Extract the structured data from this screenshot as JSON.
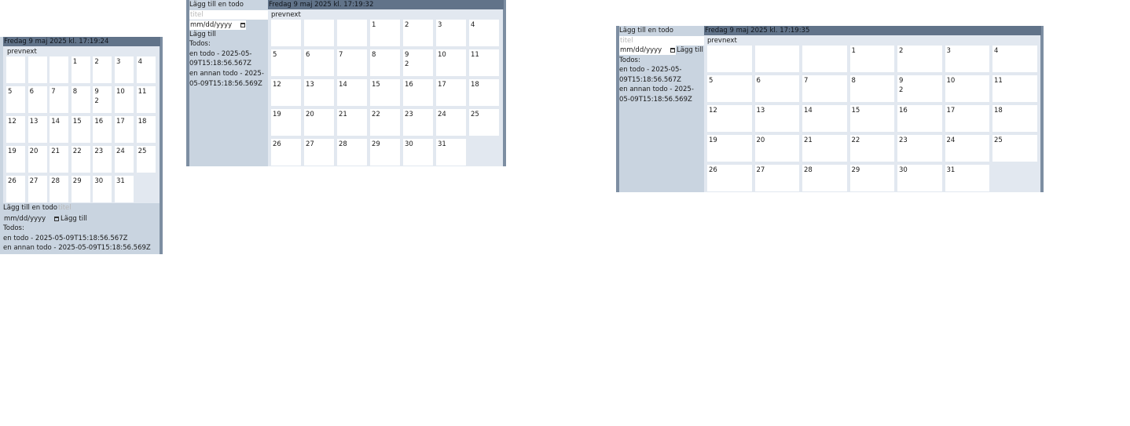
{
  "texts": {
    "prev": "prev",
    "next": "next",
    "add_heading": "Lägg till en todo",
    "title_placeholder": "titel",
    "date_placeholder": "mm/dd/yyyy",
    "add_button": "Lägg till",
    "todos_heading": "Todos:"
  },
  "windows": [
    {
      "header": "Fredag 9 maj 2025 kl. 17:19:24"
    },
    {
      "header": "Fredag 9 maj 2025 kl. 17:19:32"
    },
    {
      "header": "Fredag 9 maj 2025 kl. 17:19:35"
    }
  ],
  "calendar": {
    "leading_blanks": 3,
    "days": [
      {
        "d": "1"
      },
      {
        "d": "2"
      },
      {
        "d": "3"
      },
      {
        "d": "4"
      },
      {
        "d": "5"
      },
      {
        "d": "6"
      },
      {
        "d": "7"
      },
      {
        "d": "8"
      },
      {
        "d": "9",
        "count": "2"
      },
      {
        "d": "10"
      },
      {
        "d": "11"
      },
      {
        "d": "12"
      },
      {
        "d": "13"
      },
      {
        "d": "14"
      },
      {
        "d": "15"
      },
      {
        "d": "16"
      },
      {
        "d": "17"
      },
      {
        "d": "18"
      },
      {
        "d": "19"
      },
      {
        "d": "20"
      },
      {
        "d": "21"
      },
      {
        "d": "22"
      },
      {
        "d": "23"
      },
      {
        "d": "24"
      },
      {
        "d": "25"
      },
      {
        "d": "26"
      },
      {
        "d": "27"
      },
      {
        "d": "28"
      },
      {
        "d": "29"
      },
      {
        "d": "30"
      },
      {
        "d": "31"
      }
    ]
  },
  "todos": [
    "en todo - 2025-05-09T15:18:56.567Z",
    "en annan todo - 2025-05-09T15:18:56.569Z"
  ]
}
